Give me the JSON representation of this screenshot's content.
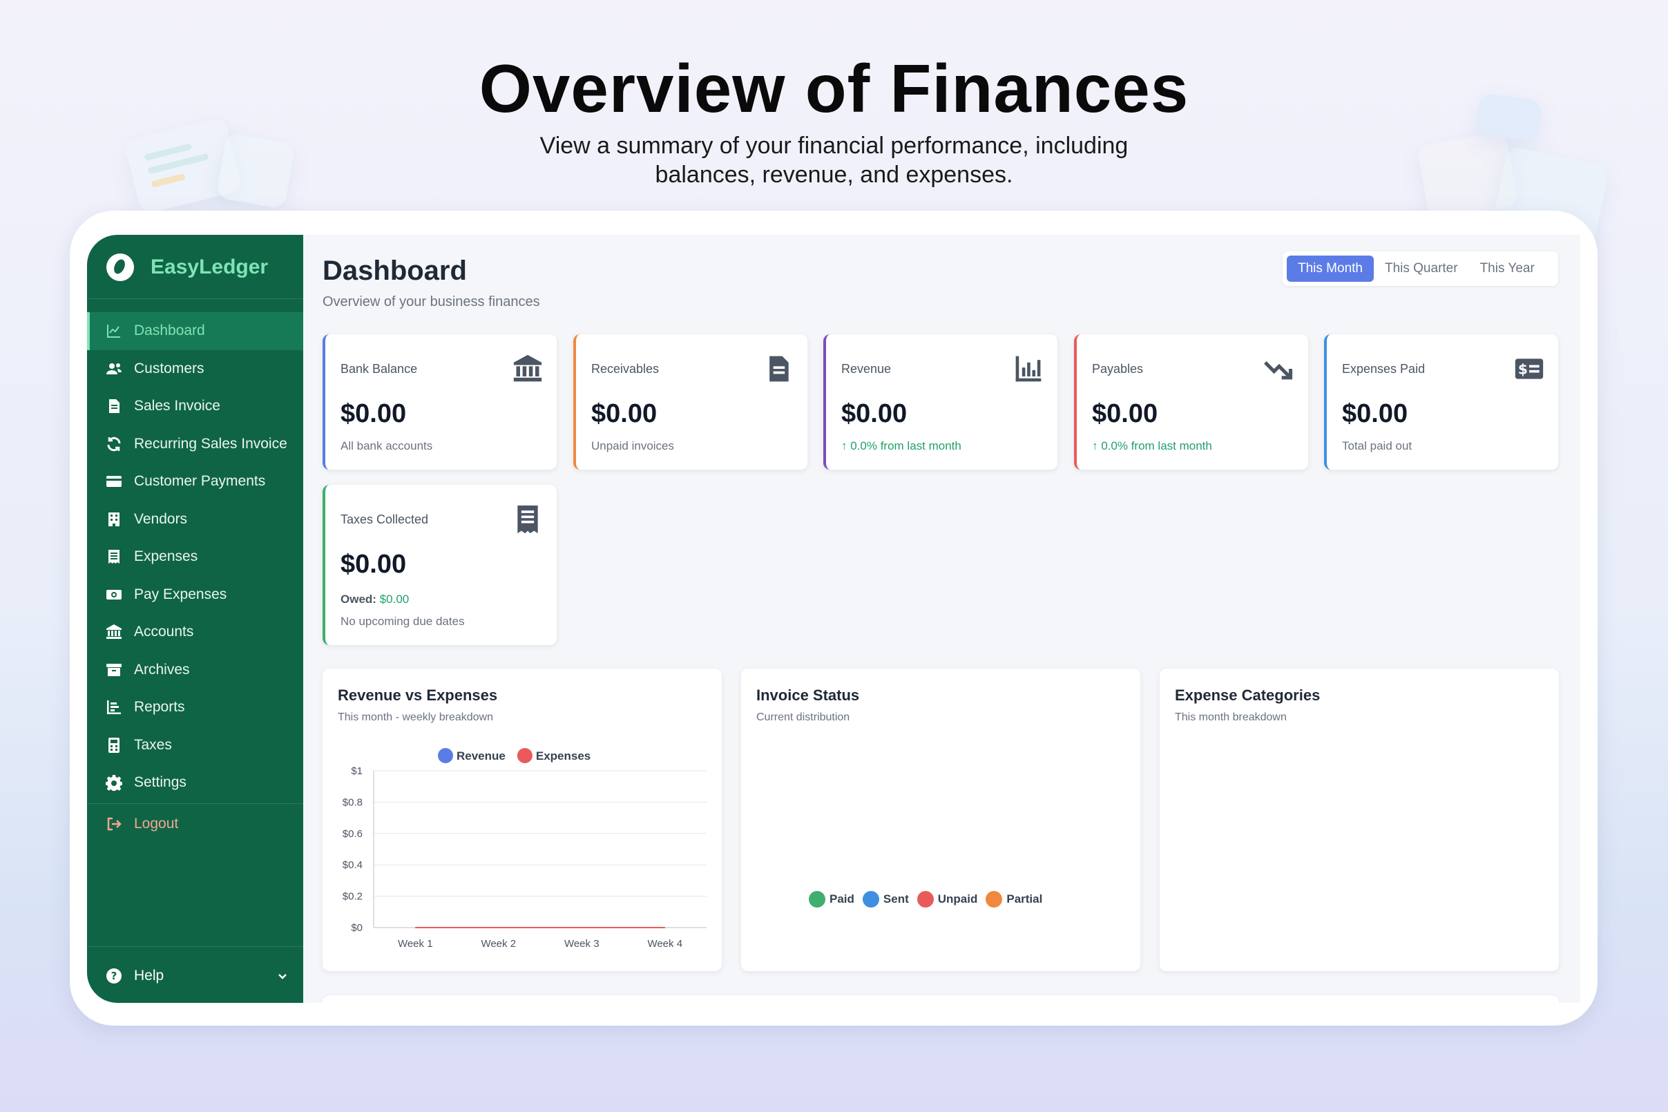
{
  "hero": {
    "title": "Overview of Finances",
    "subtitle_line1": "View a summary of your financial performance, including",
    "subtitle_line2": "balances, revenue, and expenses."
  },
  "brand": {
    "name": "EasyLedger"
  },
  "sidebar": {
    "items": [
      {
        "label": "Dashboard",
        "icon": "chart-line-icon",
        "active": true
      },
      {
        "label": "Customers",
        "icon": "users-icon"
      },
      {
        "label": "Sales Invoice",
        "icon": "document-icon"
      },
      {
        "label": "Recurring Sales Invoice",
        "icon": "refresh-icon"
      },
      {
        "label": "Customer Payments",
        "icon": "credit-card-icon"
      },
      {
        "label": "Vendors",
        "icon": "building-icon"
      },
      {
        "label": "Expenses",
        "icon": "receipt-icon"
      },
      {
        "label": "Pay Expenses",
        "icon": "money-icon"
      },
      {
        "label": "Accounts",
        "icon": "bank-icon"
      },
      {
        "label": "Archives",
        "icon": "archive-icon"
      },
      {
        "label": "Reports",
        "icon": "bar-chart-icon"
      },
      {
        "label": "Taxes",
        "icon": "calculator-icon"
      },
      {
        "label": "Settings",
        "icon": "gear-icon"
      }
    ],
    "logout": "Logout",
    "help": "Help"
  },
  "header": {
    "title": "Dashboard",
    "subtitle": "Overview of your business finances",
    "periods": [
      "This Month",
      "This Quarter",
      "This Year"
    ],
    "active_period": "This Month"
  },
  "cards": [
    {
      "label": "Bank Balance",
      "value": "$0.00",
      "note": "All bank accounts",
      "color": "#5b7ce6",
      "icon": "bank-icon"
    },
    {
      "label": "Receivables",
      "value": "$0.00",
      "note": "Unpaid invoices",
      "color": "#f0883e",
      "icon": "document-icon"
    },
    {
      "label": "Revenue",
      "value": "$0.00",
      "note": "↑ 0.0% from last month",
      "color": "#7c4dbb",
      "icon": "bar-chart-icon"
    },
    {
      "label": "Payables",
      "value": "$0.00",
      "note": "↑ 0.0% from last month",
      "color": "#e95b5b",
      "icon": "trend-down-icon"
    },
    {
      "label": "Expenses Paid",
      "value": "$0.00",
      "note": "Total paid out",
      "color": "#3f8fe0",
      "icon": "money-check-icon"
    },
    {
      "label": "Taxes Collected",
      "value": "$0.00",
      "owed_label": "Owed:",
      "owed_value": "$0.00",
      "note": "No upcoming due dates",
      "color": "#3fae6f",
      "icon": "receipt-icon"
    }
  ],
  "panels": {
    "revenue_vs_expenses": {
      "title": "Revenue vs Expenses",
      "subtitle": "This month - weekly breakdown"
    },
    "invoice_status": {
      "title": "Invoice Status",
      "subtitle": "Current distribution",
      "legend": [
        {
          "name": "Paid",
          "color": "#3fae6f"
        },
        {
          "name": "Sent",
          "color": "#3f8fe0"
        },
        {
          "name": "Unpaid",
          "color": "#e95b5b"
        },
        {
          "name": "Partial",
          "color": "#f0883e"
        }
      ]
    },
    "expense_categories": {
      "title": "Expense Categories",
      "subtitle": "This month breakdown"
    }
  },
  "chart_data": {
    "type": "line",
    "categories": [
      "Week 1",
      "Week 2",
      "Week 3",
      "Week 4"
    ],
    "series": [
      {
        "name": "Revenue",
        "values": [
          0,
          0,
          0,
          0
        ],
        "color": "#5b7ce6"
      },
      {
        "name": "Expenses",
        "values": [
          0,
          0,
          0,
          0
        ],
        "color": "#e95b5b"
      }
    ],
    "yticks": [
      "$0",
      "$0.2",
      "$0.4",
      "$0.6",
      "$0.8",
      "$1"
    ],
    "ylim": [
      0,
      1
    ],
    "grid": true,
    "legend": "top-center"
  }
}
